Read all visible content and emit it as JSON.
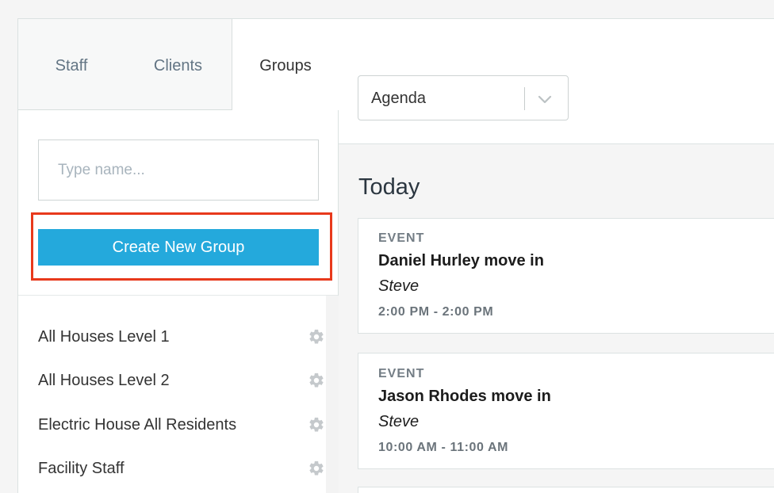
{
  "tabs": [
    {
      "label": "Staff",
      "active": false
    },
    {
      "label": "Clients",
      "active": false
    },
    {
      "label": "Groups",
      "active": true
    }
  ],
  "search": {
    "placeholder": "Type name...",
    "value": ""
  },
  "create_button": {
    "label": "Create New Group"
  },
  "groups": [
    {
      "name": "All Houses Level 1",
      "icon": "gear-icon"
    },
    {
      "name": "All Houses Level 2",
      "icon": "gear-icon"
    },
    {
      "name": "Electric House All Residents",
      "icon": "gear-icon"
    },
    {
      "name": "Facility Staff",
      "icon": "gear-icon"
    }
  ],
  "view_select": {
    "value": "Agenda"
  },
  "agenda": {
    "day_label": "Today",
    "events": [
      {
        "type": "EVENT",
        "title": "Daniel Hurley move in",
        "owner": "Steve",
        "time": "2:00 PM - 2:00 PM"
      },
      {
        "type": "EVENT",
        "title": "Jason Rhodes move in",
        "owner": "Steve",
        "time": "10:00 AM - 11:00 AM"
      }
    ]
  },
  "colors": {
    "accent": "#24a9dc",
    "highlight": "#e8391c",
    "muted_tab": "#637584"
  }
}
